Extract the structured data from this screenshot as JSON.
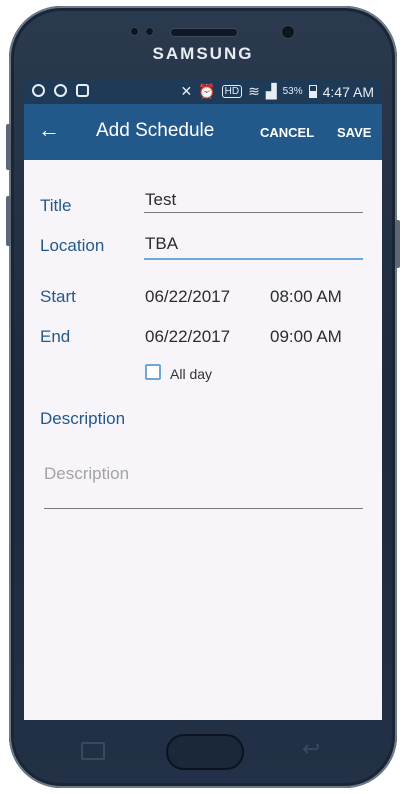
{
  "device": {
    "brand": "SAMSUNG"
  },
  "status_bar": {
    "battery_percent": "53%",
    "time": "4:47 AM"
  },
  "app_bar": {
    "title": "Add Schedule",
    "cancel_label": "CANCEL",
    "save_label": "SAVE",
    "back_icon": "arrow-left-icon"
  },
  "form": {
    "title_label": "Title",
    "title_value": "Test",
    "location_label": "Location",
    "location_value": "TBA",
    "start_label": "Start",
    "start_date": "06/22/2017",
    "start_time": "08:00 AM",
    "end_label": "End",
    "end_date": "06/22/2017",
    "end_time": "09:00 AM",
    "all_day_label": "All day",
    "all_day_checked": false,
    "description_label": "Description",
    "description_placeholder": "Description"
  },
  "colors": {
    "app_bar": "#23598a",
    "status_bar": "#1f3a57",
    "accent": "#6fa7d9",
    "label": "#23598a"
  }
}
